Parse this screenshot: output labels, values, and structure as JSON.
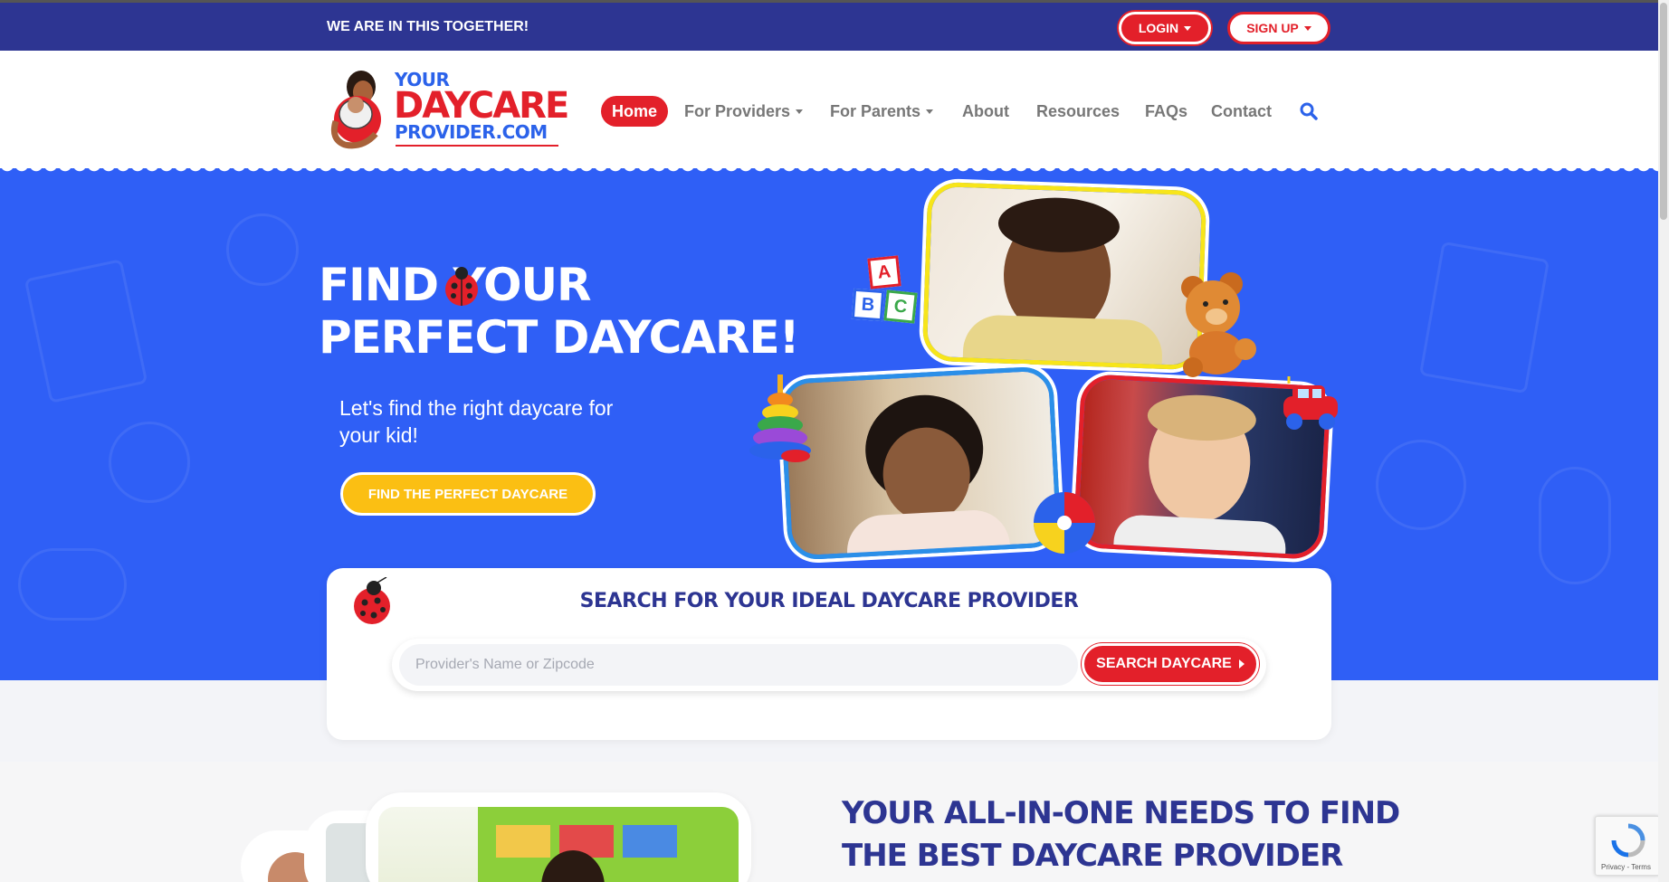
{
  "topbar": {
    "tagline": "WE ARE IN THIS TOGETHER!",
    "login_label": "LOGIN",
    "signup_label": "SIGN UP"
  },
  "logo": {
    "line1": "YOUR",
    "line2": "DAYCARE",
    "line3": "PROVIDER.COM"
  },
  "nav": {
    "home": "Home",
    "for_providers": "For Providers",
    "for_parents": "For Parents",
    "about": "About",
    "resources": "Resources",
    "faqs": "FAQs",
    "contact": "Contact"
  },
  "hero": {
    "title_line1": "FIND YOUR",
    "title_line2": "PERFECT DAYCARE!",
    "subtitle": "Let's find the right daycare for your kid!",
    "cta_label": "FIND THE PERFECT DAYCARE",
    "blocks_letters": [
      "A",
      "B",
      "C"
    ]
  },
  "search": {
    "title": "SEARCH FOR YOUR IDEAL DAYCARE PROVIDER",
    "placeholder": "Provider's Name or Zipcode",
    "button_label": "SEARCH DAYCARE"
  },
  "section2": {
    "title_line1": "YOUR ALL-IN-ONE NEEDS TO FIND",
    "title_line2": "THE BEST DAYCARE PROVIDER"
  },
  "recaptcha": {
    "terms": "Privacy - Terms"
  },
  "colors": {
    "navy": "#2d3592",
    "red": "#e3202a",
    "hero_blue": "#2f5ff6",
    "yellow": "#fbbf13"
  }
}
